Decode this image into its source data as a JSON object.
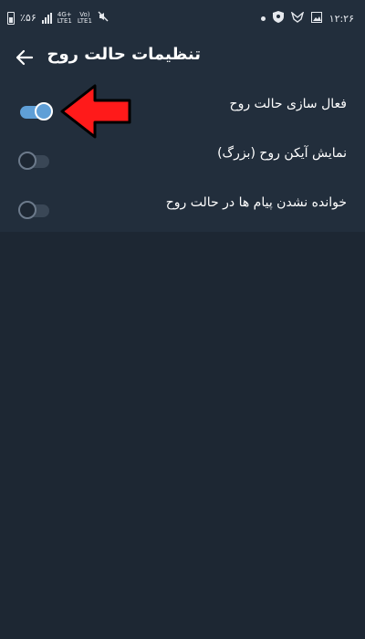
{
  "statusbar": {
    "battery_text": "٪۵۶",
    "network_top": "4G+",
    "network_bottom": "LTE1",
    "volte_top": "Vo)",
    "volte_bottom": "LTE1",
    "time": "۱۲:۲۶"
  },
  "appbar": {
    "title": "تنظیمات حالت روح"
  },
  "settings": [
    {
      "label": "فعال سازی حالت روح",
      "enabled": true
    },
    {
      "label": "نمایش آیکن روح (بزرگ)",
      "enabled": false
    },
    {
      "label": "خوانده نشدن پیام ها در حالت روح",
      "enabled": false
    }
  ],
  "colors": {
    "background": "#1d2733",
    "header": "#222e3c",
    "accent": "#5f9fd7",
    "arrow": "#ff1a1a"
  }
}
